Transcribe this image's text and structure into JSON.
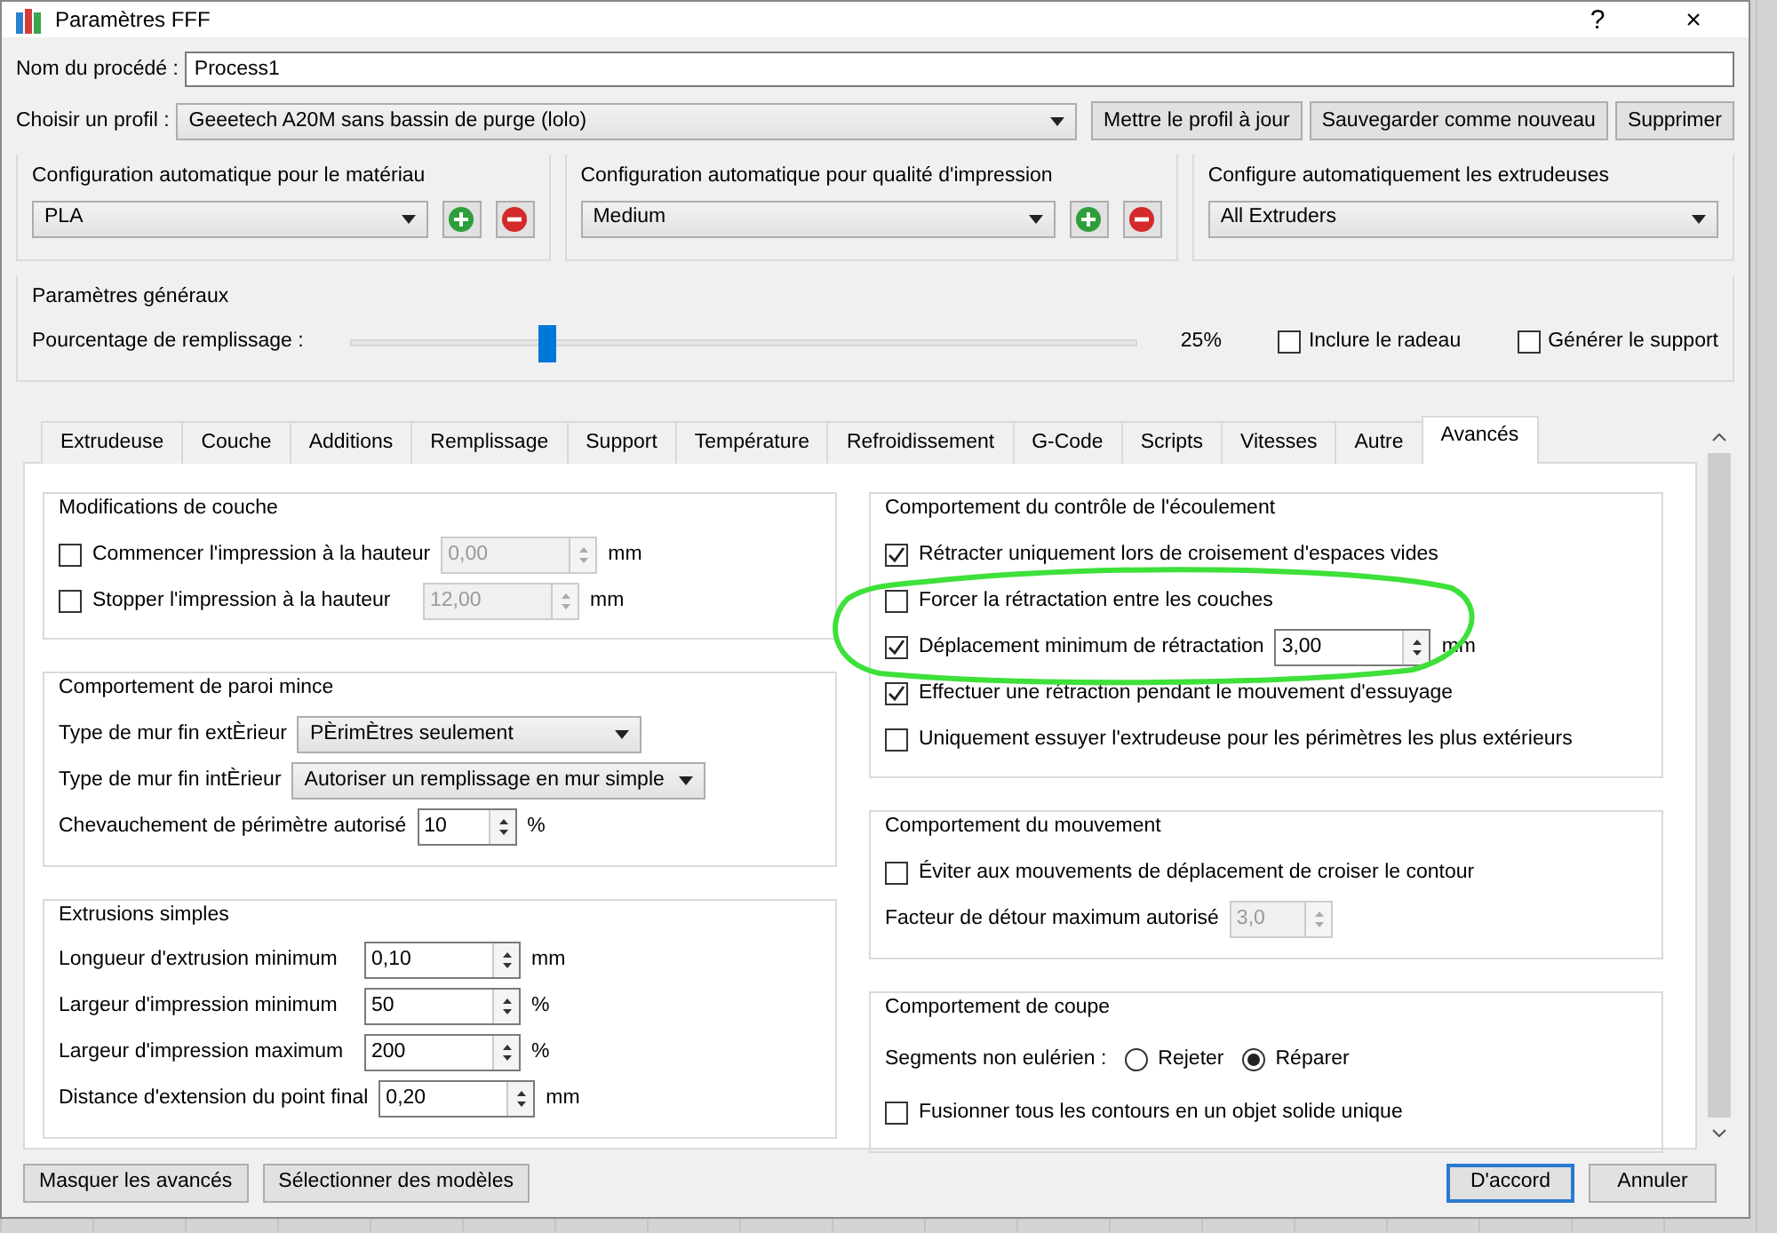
{
  "window": {
    "title": "Paramètres FFF",
    "help": "?",
    "close": "×"
  },
  "process_name": {
    "label": "Nom du procédé :",
    "value": "Process1"
  },
  "profile": {
    "label": "Choisir un profil :",
    "value": "Geeetech A20M sans bassin de purge (lolo)",
    "buttons": [
      "Mettre le profil à jour",
      "Sauvegarder comme nouveau",
      "Supprimer"
    ]
  },
  "auto_config": [
    {
      "title": "Configuration automatique pour le matériau",
      "value": "PLA",
      "add_remove": true
    },
    {
      "title": "Configuration automatique pour qualité d'impression",
      "value": "Medium",
      "add_remove": true
    },
    {
      "title": "Configure automatiquement les extrudeuses",
      "value": "All Extruders",
      "add_remove": false
    }
  ],
  "general": {
    "title": "Paramètres généraux",
    "infill_label": "Pourcentage de remplissage :",
    "level": 0.25,
    "reading": "25%",
    "options": [
      {
        "label": "Inclure le radeau",
        "checked": false
      },
      {
        "label": "Générer le support",
        "checked": false
      }
    ]
  },
  "tabs": [
    {
      "label": "Extrudeuse",
      "selected": false
    },
    {
      "label": "Couche",
      "selected": false
    },
    {
      "label": "Additions",
      "selected": false
    },
    {
      "label": "Remplissage",
      "selected": false
    },
    {
      "label": "Support",
      "selected": false
    },
    {
      "label": "Température",
      "selected": false
    },
    {
      "label": "Refroidissement",
      "selected": false
    },
    {
      "label": "G-Code",
      "selected": false
    },
    {
      "label": "Scripts",
      "selected": false
    },
    {
      "label": "Vitesses",
      "selected": false
    },
    {
      "label": "Autre",
      "selected": false
    },
    {
      "label": "Avancés",
      "selected": true
    }
  ],
  "columns": [
    {
      "groups": [
        {
          "title": "Modifications de couche",
          "rows": [
            {
              "kind": "check_spin",
              "label": "Commencer l'impression à la hauteur",
              "checked": false,
              "value": "0,00",
              "unit": "mm",
              "disabled": true
            },
            {
              "kind": "check_spin",
              "label": "Stopper  l'impression à la hauteur",
              "checked": false,
              "value": "12,00",
              "unit": "mm",
              "disabled": true
            }
          ]
        },
        {
          "title": "Comportement de paroi mince",
          "rows": [
            {
              "kind": "select",
              "label": "Type de mur fin extÈrieur",
              "value": "PÈrimÈtres seulement"
            },
            {
              "kind": "select",
              "label": "Type de mur fin intÈrieur",
              "value": "Autoriser un remplissage en mur simple"
            },
            {
              "kind": "spin",
              "label": "Chevauchement de périmètre autorisé",
              "value": "10",
              "unit": "%",
              "disabled": false
            }
          ]
        },
        {
          "title": "Extrusions simples",
          "rows": [
            {
              "kind": "spin",
              "label": "Longueur d'extrusion minimum",
              "value": "0,10",
              "unit": "mm",
              "disabled": false
            },
            {
              "kind": "spin",
              "label": "Largeur d'impression minimum",
              "value": "50",
              "unit": "%",
              "disabled": false
            },
            {
              "kind": "spin",
              "label": "Largeur d'impression maximum",
              "value": "200",
              "unit": "%",
              "disabled": false
            },
            {
              "kind": "spin",
              "label": "Distance d'extension du point final",
              "value": "0,20",
              "unit": "mm",
              "disabled": false
            }
          ]
        }
      ]
    },
    {
      "groups": [
        {
          "title": "Comportement du contrôle de l'écoulement",
          "rows": [
            {
              "kind": "check",
              "label": "Rétracter uniquement lors de croisement d'espaces vides",
              "checked": true
            },
            {
              "kind": "check",
              "label": "Forcer la rétractation entre les couches",
              "checked": false
            },
            {
              "kind": "check_spin",
              "label": "Déplacement minimum de rétractation",
              "checked": true,
              "value": "3,00",
              "unit": "mm",
              "disabled": false
            },
            {
              "kind": "check",
              "label": "Effectuer une rétraction pendant le mouvement d'essuyage",
              "checked": true
            },
            {
              "kind": "check",
              "label": "Uniquement essuyer l'extrudeuse pour les périmètres les plus extérieurs",
              "checked": false
            }
          ]
        },
        {
          "title": "Comportement du mouvement",
          "rows": [
            {
              "kind": "check",
              "label": "Éviter aux mouvements de déplacement de croiser le contour",
              "checked": false
            },
            {
              "kind": "spin",
              "label": "Facteur de détour maximum autorisé",
              "value": "3,0",
              "disabled": true
            }
          ]
        },
        {
          "title": "Comportement de coupe",
          "rows": [
            {
              "kind": "radio",
              "label": "Segments non eulérien :",
              "options": [
                {
                  "label": "Rejeter",
                  "selected": false
                },
                {
                  "label": "Réparer",
                  "selected": true
                }
              ]
            },
            {
              "kind": "check",
              "label": "Fusionner tous les contours en un objet solide unique",
              "checked": false
            }
          ]
        }
      ]
    }
  ],
  "footer": {
    "left_buttons": [
      "Masquer les avancés",
      "Sélectionner des modèles"
    ],
    "right_buttons": [
      {
        "label": "D'accord",
        "default": true
      },
      {
        "label": "Annuler",
        "default": false
      }
    ]
  }
}
